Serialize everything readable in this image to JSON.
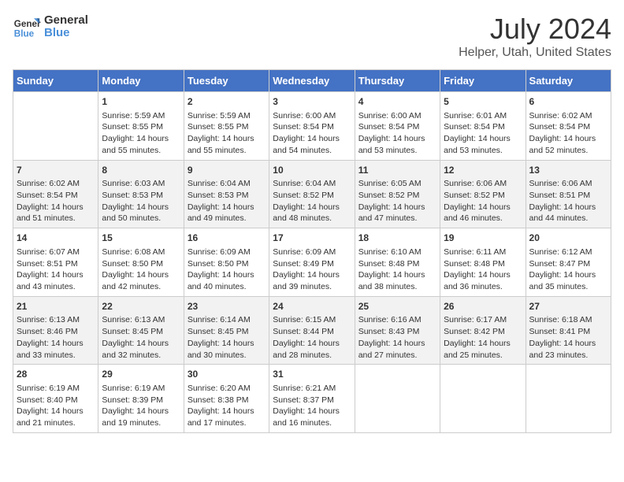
{
  "logo": {
    "line1": "General",
    "line2": "Blue"
  },
  "title": "July 2024",
  "subtitle": "Helper, Utah, United States",
  "days_of_week": [
    "Sunday",
    "Monday",
    "Tuesday",
    "Wednesday",
    "Thursday",
    "Friday",
    "Saturday"
  ],
  "weeks": [
    [
      {
        "day": "",
        "info": ""
      },
      {
        "day": "1",
        "info": "Sunrise: 5:59 AM\nSunset: 8:55 PM\nDaylight: 14 hours\nand 55 minutes."
      },
      {
        "day": "2",
        "info": "Sunrise: 5:59 AM\nSunset: 8:55 PM\nDaylight: 14 hours\nand 55 minutes."
      },
      {
        "day": "3",
        "info": "Sunrise: 6:00 AM\nSunset: 8:54 PM\nDaylight: 14 hours\nand 54 minutes."
      },
      {
        "day": "4",
        "info": "Sunrise: 6:00 AM\nSunset: 8:54 PM\nDaylight: 14 hours\nand 53 minutes."
      },
      {
        "day": "5",
        "info": "Sunrise: 6:01 AM\nSunset: 8:54 PM\nDaylight: 14 hours\nand 53 minutes."
      },
      {
        "day": "6",
        "info": "Sunrise: 6:02 AM\nSunset: 8:54 PM\nDaylight: 14 hours\nand 52 minutes."
      }
    ],
    [
      {
        "day": "7",
        "info": "Sunrise: 6:02 AM\nSunset: 8:54 PM\nDaylight: 14 hours\nand 51 minutes."
      },
      {
        "day": "8",
        "info": "Sunrise: 6:03 AM\nSunset: 8:53 PM\nDaylight: 14 hours\nand 50 minutes."
      },
      {
        "day": "9",
        "info": "Sunrise: 6:04 AM\nSunset: 8:53 PM\nDaylight: 14 hours\nand 49 minutes."
      },
      {
        "day": "10",
        "info": "Sunrise: 6:04 AM\nSunset: 8:52 PM\nDaylight: 14 hours\nand 48 minutes."
      },
      {
        "day": "11",
        "info": "Sunrise: 6:05 AM\nSunset: 8:52 PM\nDaylight: 14 hours\nand 47 minutes."
      },
      {
        "day": "12",
        "info": "Sunrise: 6:06 AM\nSunset: 8:52 PM\nDaylight: 14 hours\nand 46 minutes."
      },
      {
        "day": "13",
        "info": "Sunrise: 6:06 AM\nSunset: 8:51 PM\nDaylight: 14 hours\nand 44 minutes."
      }
    ],
    [
      {
        "day": "14",
        "info": "Sunrise: 6:07 AM\nSunset: 8:51 PM\nDaylight: 14 hours\nand 43 minutes."
      },
      {
        "day": "15",
        "info": "Sunrise: 6:08 AM\nSunset: 8:50 PM\nDaylight: 14 hours\nand 42 minutes."
      },
      {
        "day": "16",
        "info": "Sunrise: 6:09 AM\nSunset: 8:50 PM\nDaylight: 14 hours\nand 40 minutes."
      },
      {
        "day": "17",
        "info": "Sunrise: 6:09 AM\nSunset: 8:49 PM\nDaylight: 14 hours\nand 39 minutes."
      },
      {
        "day": "18",
        "info": "Sunrise: 6:10 AM\nSunset: 8:48 PM\nDaylight: 14 hours\nand 38 minutes."
      },
      {
        "day": "19",
        "info": "Sunrise: 6:11 AM\nSunset: 8:48 PM\nDaylight: 14 hours\nand 36 minutes."
      },
      {
        "day": "20",
        "info": "Sunrise: 6:12 AM\nSunset: 8:47 PM\nDaylight: 14 hours\nand 35 minutes."
      }
    ],
    [
      {
        "day": "21",
        "info": "Sunrise: 6:13 AM\nSunset: 8:46 PM\nDaylight: 14 hours\nand 33 minutes."
      },
      {
        "day": "22",
        "info": "Sunrise: 6:13 AM\nSunset: 8:45 PM\nDaylight: 14 hours\nand 32 minutes."
      },
      {
        "day": "23",
        "info": "Sunrise: 6:14 AM\nSunset: 8:45 PM\nDaylight: 14 hours\nand 30 minutes."
      },
      {
        "day": "24",
        "info": "Sunrise: 6:15 AM\nSunset: 8:44 PM\nDaylight: 14 hours\nand 28 minutes."
      },
      {
        "day": "25",
        "info": "Sunrise: 6:16 AM\nSunset: 8:43 PM\nDaylight: 14 hours\nand 27 minutes."
      },
      {
        "day": "26",
        "info": "Sunrise: 6:17 AM\nSunset: 8:42 PM\nDaylight: 14 hours\nand 25 minutes."
      },
      {
        "day": "27",
        "info": "Sunrise: 6:18 AM\nSunset: 8:41 PM\nDaylight: 14 hours\nand 23 minutes."
      }
    ],
    [
      {
        "day": "28",
        "info": "Sunrise: 6:19 AM\nSunset: 8:40 PM\nDaylight: 14 hours\nand 21 minutes."
      },
      {
        "day": "29",
        "info": "Sunrise: 6:19 AM\nSunset: 8:39 PM\nDaylight: 14 hours\nand 19 minutes."
      },
      {
        "day": "30",
        "info": "Sunrise: 6:20 AM\nSunset: 8:38 PM\nDaylight: 14 hours\nand 17 minutes."
      },
      {
        "day": "31",
        "info": "Sunrise: 6:21 AM\nSunset: 8:37 PM\nDaylight: 14 hours\nand 16 minutes."
      },
      {
        "day": "",
        "info": ""
      },
      {
        "day": "",
        "info": ""
      },
      {
        "day": "",
        "info": ""
      }
    ]
  ]
}
